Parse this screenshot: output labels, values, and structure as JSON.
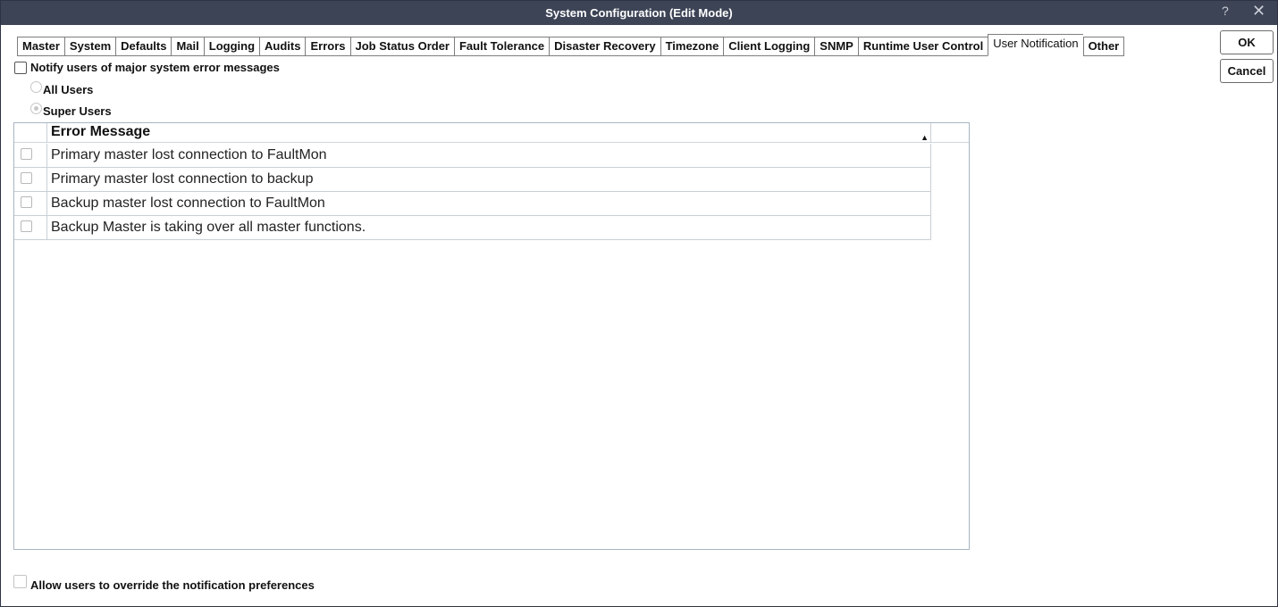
{
  "window": {
    "title": "System Configuration (Edit Mode)",
    "help_glyph": "?",
    "close_glyph": "✕"
  },
  "tabs": [
    {
      "label": "Master"
    },
    {
      "label": "System"
    },
    {
      "label": "Defaults"
    },
    {
      "label": "Mail"
    },
    {
      "label": "Logging"
    },
    {
      "label": "Audits"
    },
    {
      "label": "Errors"
    },
    {
      "label": "Job Status Order"
    },
    {
      "label": "Fault Tolerance"
    },
    {
      "label": "Disaster Recovery"
    },
    {
      "label": "Timezone"
    },
    {
      "label": "Client Logging"
    },
    {
      "label": "SNMP"
    },
    {
      "label": "Runtime User Control"
    },
    {
      "label": "User Notification"
    },
    {
      "label": "Other"
    }
  ],
  "active_tab": "User Notification",
  "buttons": {
    "ok": "OK",
    "cancel": "Cancel"
  },
  "notify": {
    "label": "Notify users of major system error messages",
    "checked": false
  },
  "recipients": {
    "options": [
      {
        "label": "All Users",
        "selected": false
      },
      {
        "label": "Super Users",
        "selected": true
      }
    ]
  },
  "grid": {
    "column_header": "Error Message",
    "sort_glyph": "▲",
    "rows": [
      {
        "message": "Primary master lost connection to FaultMon",
        "checked": false
      },
      {
        "message": "Primary master lost connection to backup",
        "checked": false
      },
      {
        "message": "Backup master lost connection to FaultMon",
        "checked": false
      },
      {
        "message": "Backup Master is taking over all master functions.",
        "checked": false
      }
    ]
  },
  "override": {
    "label": "Allow users to override the notification preferences",
    "checked": false
  }
}
